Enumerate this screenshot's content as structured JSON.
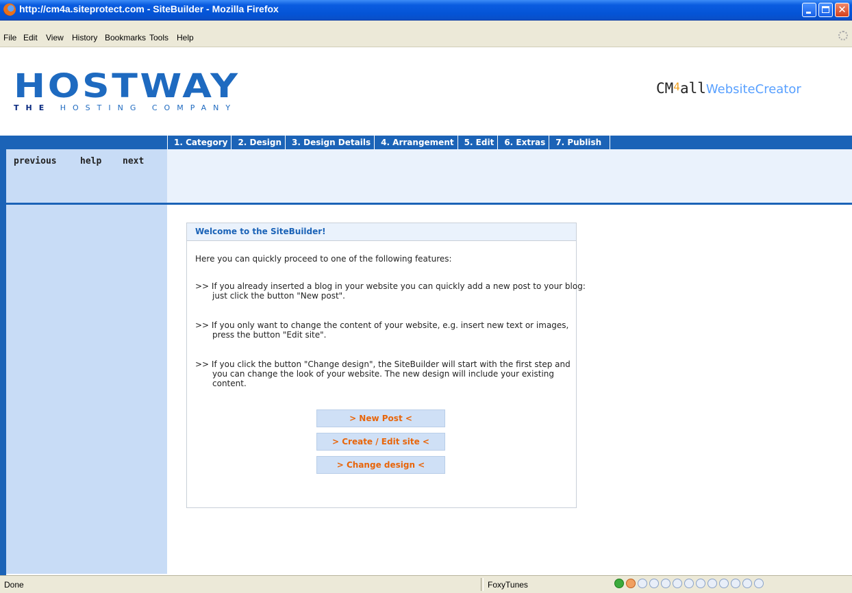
{
  "window": {
    "title": "http://cm4a.siteprotect.com - SiteBuilder - Mozilla Firefox",
    "close_glyph": "✕"
  },
  "menubar": {
    "items": [
      "File",
      "Edit",
      "View",
      "History",
      "Bookmarks",
      "Tools",
      "Help"
    ]
  },
  "header": {
    "logo_main": "HOSTWAY",
    "logo_sub_the": "THE",
    "logo_sub_rest": "HOSTING COMPANY",
    "brand_cm": "CM",
    "brand_4": "4",
    "brand_all": "all",
    "brand_wc": "WebsiteCreator"
  },
  "steps": [
    "1. Category",
    "2. Design",
    "3. Design Details",
    "4. Arrangement",
    "5. Edit",
    "6. Extras",
    "7. Publish"
  ],
  "subnav": {
    "previous": "previous",
    "help": "help",
    "next": "next"
  },
  "welcome": {
    "title": "Welcome to the SiteBuilder!",
    "intro": "Here you can quickly proceed to one of the following features:",
    "items": [
      ">> If you already inserted a blog in your website you can quickly add a new post to your blog: just click the button \"New post\".",
      ">> If you only want to change the content of your website, e.g. insert new text or images, press the button \"Edit site\".",
      ">> If you click the button \"Change design\", the SiteBuilder will start with the first step and you can change the look of your website. The new design will include your existing content."
    ],
    "buttons": {
      "new_post": "> New Post <",
      "create_edit": "> Create / Edit site <",
      "change_design": "> Change design <"
    }
  },
  "statusbar": {
    "status": "Done",
    "foxytunes": "FoxyTunes"
  },
  "colors": {
    "brand_blue": "#1b63b7",
    "button_text": "#e8650a",
    "panel_header": "#eaf2fc"
  }
}
